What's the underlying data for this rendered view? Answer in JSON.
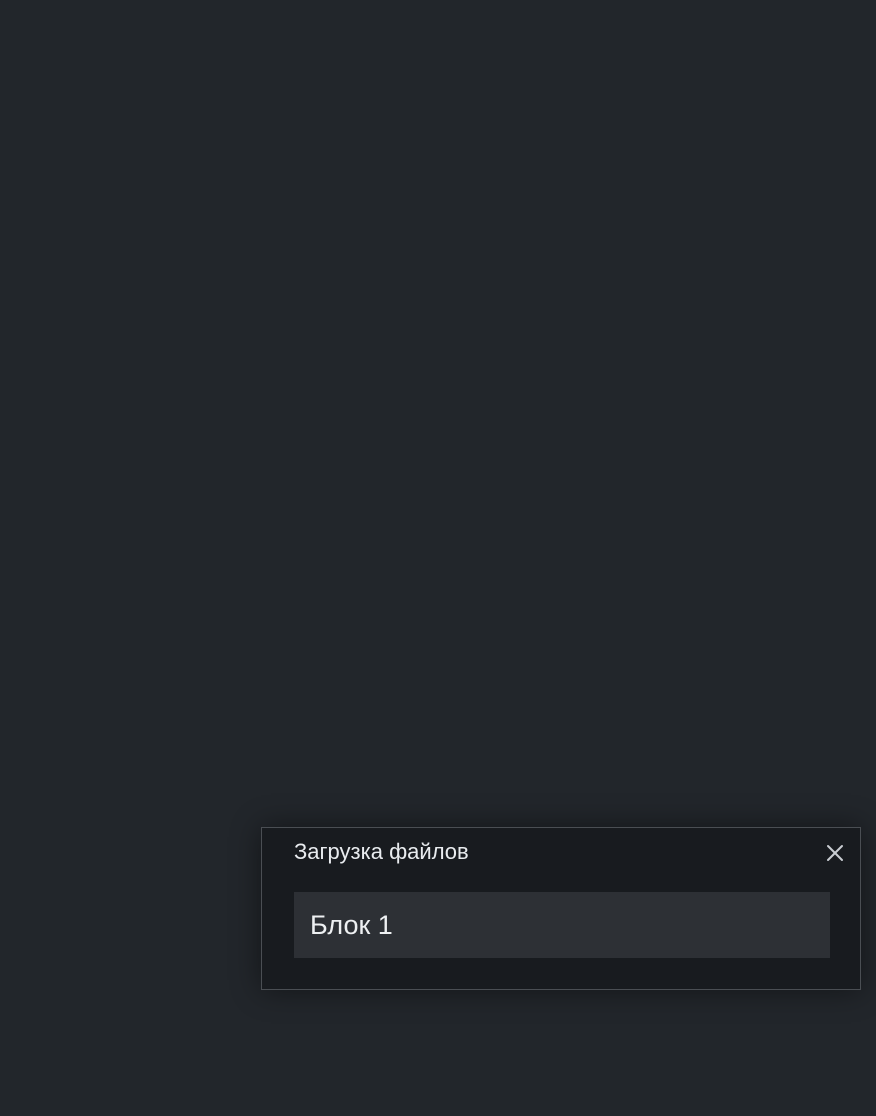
{
  "upload_panel": {
    "title": "Загрузка файлов",
    "close_icon": "close-icon",
    "items": [
      {
        "label": "Блок 1"
      }
    ]
  },
  "colors": {
    "background": "#22262b",
    "panel_background": "#181b1f",
    "panel_border": "#4a4e53",
    "item_background": "#2d3035",
    "text": "#e9ecef"
  }
}
